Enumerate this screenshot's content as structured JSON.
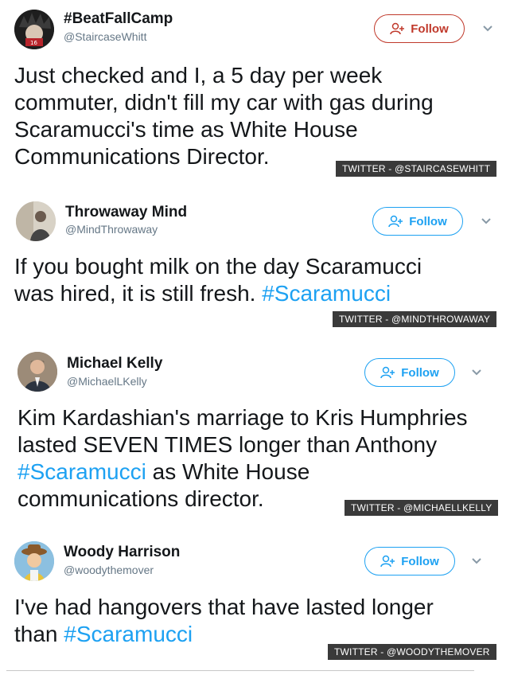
{
  "tweets": [
    {
      "name": "#BeatFallCamp",
      "handle": "@StaircaseWhitt",
      "follow_label": "Follow",
      "text": "Just checked and I, a 5 day per week\ncommuter, didn't fill my car with gas during\nScaramucci's time as White House\nCommunications Director.",
      "caption": "TWITTER - @STAIRCASEWHITT"
    },
    {
      "name": "Throwaway Mind",
      "handle": "@MindThrowaway",
      "follow_label": "Follow",
      "text_before": "If you bought milk on the day Scaramucci\nwas hired, it is still fresh. ",
      "hashtag": "#Scaramucci",
      "caption": "TWITTER - @MINDTHROWAWAY"
    },
    {
      "name": "Michael Kelly",
      "handle": "@MichaelLKelly",
      "follow_label": "Follow",
      "text_before": "Kim Kardashian's marriage to Kris Humphries\nlasted SEVEN TIMES longer than Anthony\n",
      "hashtag": "#Scaramucci",
      "text_after": " as White House\ncommunications director.",
      "caption": "TWITTER - @MICHAELLKELLY"
    },
    {
      "name": "Woody Harrison",
      "handle": "@woodythemover",
      "follow_label": "Follow",
      "text_before": "I've had hangovers that have lasted longer\nthan ",
      "hashtag": "#Scaramucci",
      "caption": "TWITTER - @WOODYTHEMOVER"
    }
  ],
  "colors": {
    "link": "#1da1f2",
    "follow_red": "#c0392b",
    "caption_bg": "#3a3a3a"
  },
  "icons": {
    "follow": "add-person-icon",
    "menu": "chevron-down-icon"
  }
}
